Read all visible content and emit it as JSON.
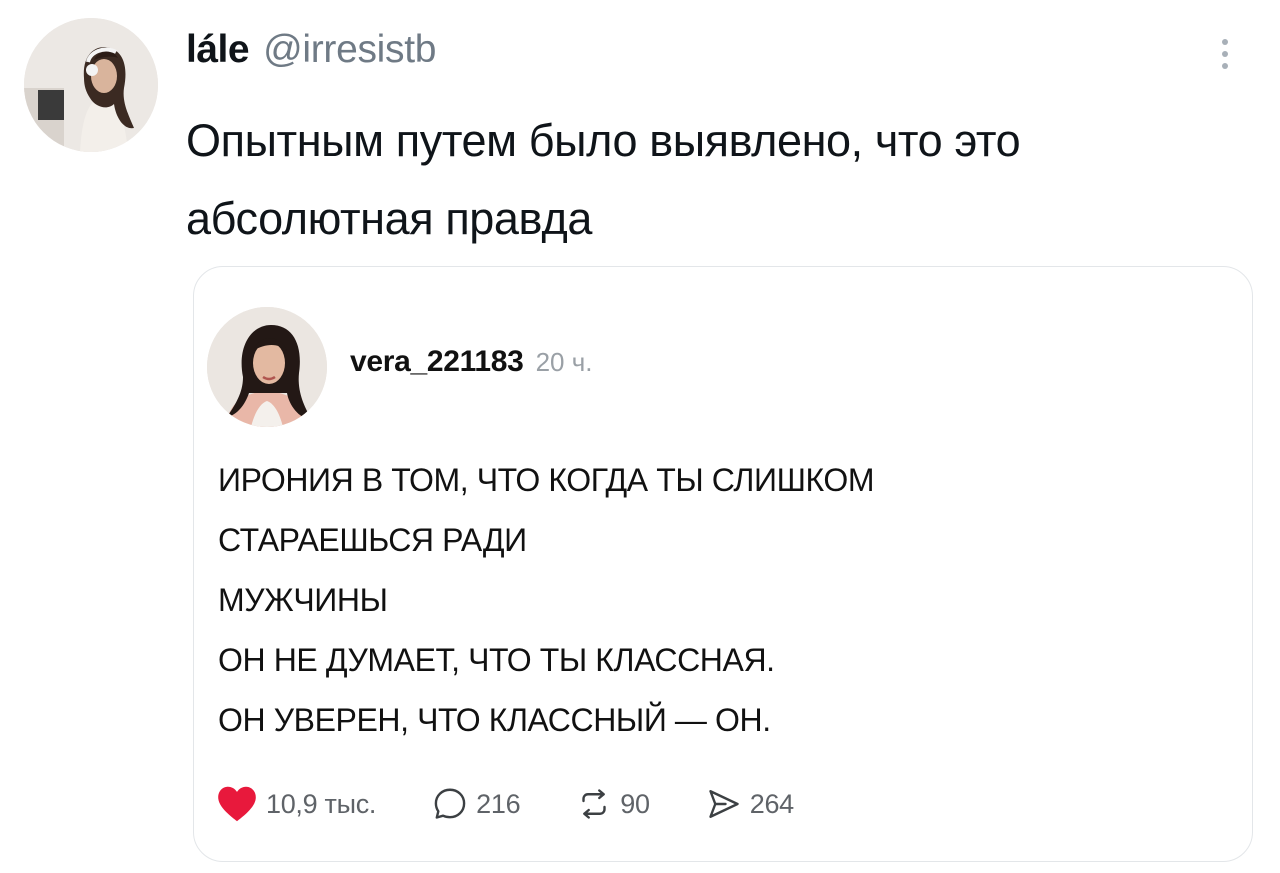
{
  "post": {
    "author": {
      "display_name": "lále",
      "handle": "@irresistb"
    },
    "text": "Опытным путем было выявлено, что это абсолютная правда",
    "icons": {
      "more": "more-vertical-icon"
    }
  },
  "quote": {
    "username": "vera_221183",
    "time": "20 ч.",
    "lines": [
      "ИРОНИЯ В ТОМ, ЧТО КОГДА ТЫ СЛИШКОМ",
      "СТАРАЕШЬСЯ РАДИ",
      "МУЖЧИНЫ",
      "ОН НЕ ДУМАЕТ, ЧТО ТЫ КЛАССНАЯ.",
      "ОН УВЕРЕН, ЧТО КЛАССНЫЙ — ОН."
    ],
    "actions": {
      "likes": "10,9 тыс.",
      "comments": "216",
      "reposts": "90",
      "shares": "264"
    },
    "icons": {
      "like": "heart-icon",
      "comment": "comment-bubble-icon",
      "repost": "repost-icon",
      "share": "send-icon"
    },
    "colors": {
      "like": "#e8193c"
    }
  }
}
